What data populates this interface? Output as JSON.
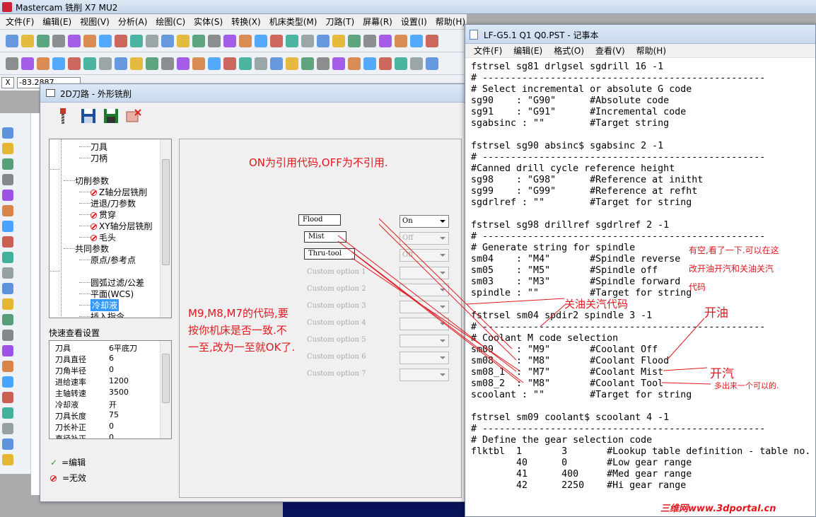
{
  "mastercam": {
    "title": "Mastercam 铣削 X7 MU2",
    "menu": [
      "文件(F)",
      "编辑(E)",
      "视图(V)",
      "分析(A)",
      "绘图(C)",
      "实体(S)",
      "转换(X)",
      "机床类型(M)",
      "刀路(T)",
      "屏幕(R)",
      "设置(I)",
      "帮助(H)"
    ],
    "coord_axis": "X",
    "coord_value": "-83.2887"
  },
  "dialog": {
    "title": "2D刀路 - 外形铣削",
    "tree": [
      {
        "label": "刀具",
        "icon": "none"
      },
      {
        "label": "刀柄",
        "icon": "none"
      },
      {
        "label": "",
        "icon": "none"
      },
      {
        "label": "切削参数",
        "icon": "none"
      },
      {
        "label": "Z轴分层铣削",
        "icon": "invalid"
      },
      {
        "label": "进退/刀参数",
        "icon": "none"
      },
      {
        "label": "贯穿",
        "icon": "invalid"
      },
      {
        "label": "XY轴分层铣削",
        "icon": "invalid"
      },
      {
        "label": "毛头",
        "icon": "invalid"
      },
      {
        "label": "共同参数",
        "icon": "none"
      },
      {
        "label": "原点/参考点",
        "icon": "none"
      },
      {
        "label": "",
        "icon": "none"
      },
      {
        "label": "圆弧过滤/公差",
        "icon": "none"
      },
      {
        "label": "平面(WCS)",
        "icon": "none"
      },
      {
        "label": "冷却液",
        "icon": "none",
        "selected": true
      },
      {
        "label": "插入指令",
        "icon": "none"
      }
    ],
    "quick_view_label": "快速查看设置",
    "quick_view": [
      {
        "k": "刀具",
        "v": "6平底刀"
      },
      {
        "k": "刀具直径",
        "v": "6"
      },
      {
        "k": "刀角半径",
        "v": "0"
      },
      {
        "k": "进给速率",
        "v": "1200"
      },
      {
        "k": "主轴转速",
        "v": "3500"
      },
      {
        "k": "冷却液",
        "v": "开"
      },
      {
        "k": "刀具长度",
        "v": "75"
      },
      {
        "k": "刀长补正",
        "v": "0"
      },
      {
        "k": "直径补正",
        "v": "0"
      }
    ],
    "legend_edit": "=编辑",
    "legend_invalid": "=无效",
    "coolant": [
      {
        "label": "Flood",
        "value": "On",
        "active": true
      },
      {
        "label": "Mist",
        "value": "Off",
        "active": false
      },
      {
        "label": "Thru-tool",
        "value": "Off",
        "active": false
      }
    ],
    "custom_options": [
      "Custom option 1",
      "Custom option 2",
      "Custom option 3",
      "Custom option 4",
      "Custom option 5",
      "Custom option 6",
      "Custom option 7"
    ],
    "annotation_top": "ON为引用代码,OFF为不引用.",
    "annotation_left": [
      "M9,M8,M7的代码,要",
      "按你机床是否一致.不",
      "一至,改为一至就OK了."
    ]
  },
  "notepad": {
    "title": "LF-G5.1 Q1 Q0.PST - 记事本",
    "menu": [
      "文件(F)",
      "编辑(E)",
      "格式(O)",
      "查看(V)",
      "帮助(H)"
    ],
    "lines": [
      "fstrsel sg81 drlgsel sgdrill 16 -1",
      "# --------------------------------------------------",
      "# Select incremental or absolute G code",
      "sg90    : \"G90\"      #Absolute code",
      "sg91    : \"G91\"      #Incremental code",
      "sgabsinc : \"\"        #Target string",
      "",
      "fstrsel sg90 absinc$ sgabsinc 2 -1",
      "# --------------------------------------------------",
      "#Canned drill cycle reference height",
      "sg98    : \"G98\"      #Reference at initht",
      "sg99    : \"G99\"      #Reference at refht",
      "sgdrlref : \"\"        #Target for string",
      "",
      "fstrsel sg98 drillref sgdrlref 2 -1",
      "# --------------------------------------------------",
      "# Generate string for spindle",
      "sm04    : \"M4\"       #Spindle reverse",
      "sm05    : \"M5\"       #Spindle off",
      "sm03    : \"M3\"       #Spindle forward",
      "spindle : \"\"         #Target for string",
      "",
      "fstrsel sm04 spdir2 spindle 3 -1",
      "# --------------------------------------------------",
      "# Coolant M code selection",
      "sm09    : \"M9\"       #Coolant Off",
      "sm08    : \"M8\"       #Coolant Flood",
      "sm08_1  : \"M7\"       #Coolant Mist",
      "sm08_2  : \"M8\"       #Coolant Tool",
      "scoolant : \"\"        #Target for string",
      "",
      "fstrsel sm09 coolant$ scoolant 4 -1",
      "# --------------------------------------------------",
      "# Define the gear selection code",
      "flktbl  1       3       #Lookup table definition - table no.",
      "        40      0       #Low gear range",
      "        41      400     #Med gear range",
      "        42      2250    #Hi gear range"
    ],
    "annotation_right": [
      "有空,看了一下.可以在这",
      "改开油开汽和关油关汽",
      "代码"
    ],
    "annotation_coolant_off": "关油关汽代码",
    "annotation_flood": "开油",
    "annotation_mist": "开汽",
    "annotation_extra": "多出来一个可以的."
  },
  "watermark": "三维网www.3dportal.cn"
}
